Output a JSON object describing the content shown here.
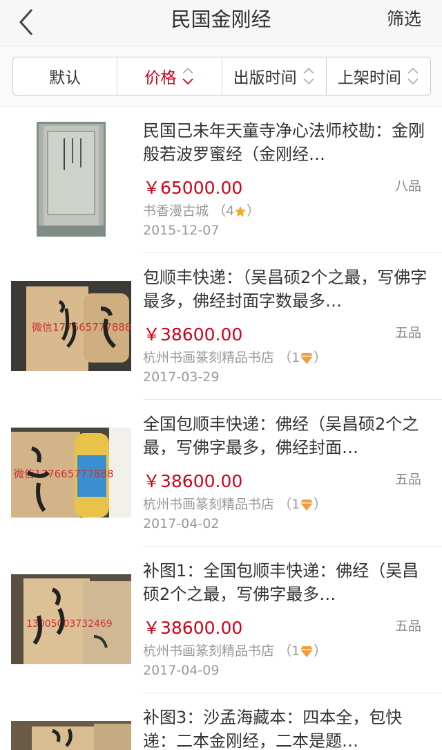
{
  "header": {
    "title": "民国金刚经",
    "filter_label": "筛选"
  },
  "sort": {
    "tabs": [
      {
        "label": "默认"
      },
      {
        "label": "价格"
      },
      {
        "label": "出版时间"
      },
      {
        "label": "上架时间"
      }
    ],
    "active_color": "#d0021b"
  },
  "items": [
    {
      "name": "民国己未年天童寺净心法师校勘：金刚般若波罗蜜经（金刚经…",
      "price": "￥65000.00",
      "condition": "八品",
      "shop": "书香漫古城",
      "rating_open": "（4",
      "rating_close": "）",
      "badge_icon": "star-icon",
      "date": "2015-12-07"
    },
    {
      "name": "包顺丰快递：（吴昌硕2个之最，写佛字最多，佛经封面字数最多…",
      "price": "￥38600.00",
      "condition": "五品",
      "shop": "杭州书画篆刻精品书店",
      "rating_open": "（1",
      "rating_close": "）",
      "badge_icon": "diamond-icon",
      "date": "2017-03-29"
    },
    {
      "name": "全国包顺丰快递：佛经（吴昌硕2个之最，写佛字最多，佛经封面…",
      "price": "￥38600.00",
      "condition": "五品",
      "shop": "杭州书画篆刻精品书店",
      "rating_open": "（1",
      "rating_close": "）",
      "badge_icon": "diamond-icon",
      "date": "2017-04-02"
    },
    {
      "name": "补图1：全国包顺丰快递：佛经（吴昌硕2个之最，写佛字最多…",
      "price": "￥38600.00",
      "condition": "五品",
      "shop": "杭州书画篆刻精品书店",
      "rating_open": "（1",
      "rating_close": "）",
      "badge_icon": "diamond-icon",
      "date": "2017-04-09"
    },
    {
      "name": "补图3：沙孟海藏本：四本全，包快递：二本金刚经，二本是题…",
      "price": "",
      "condition": "",
      "shop": "",
      "rating_open": "",
      "rating_close": "",
      "badge_icon": "",
      "date": ""
    }
  ],
  "thumb_text": {
    "item1_text": "微信177665777888",
    "item2_text": "微信177665777888",
    "item3_text": "13005003732469"
  }
}
